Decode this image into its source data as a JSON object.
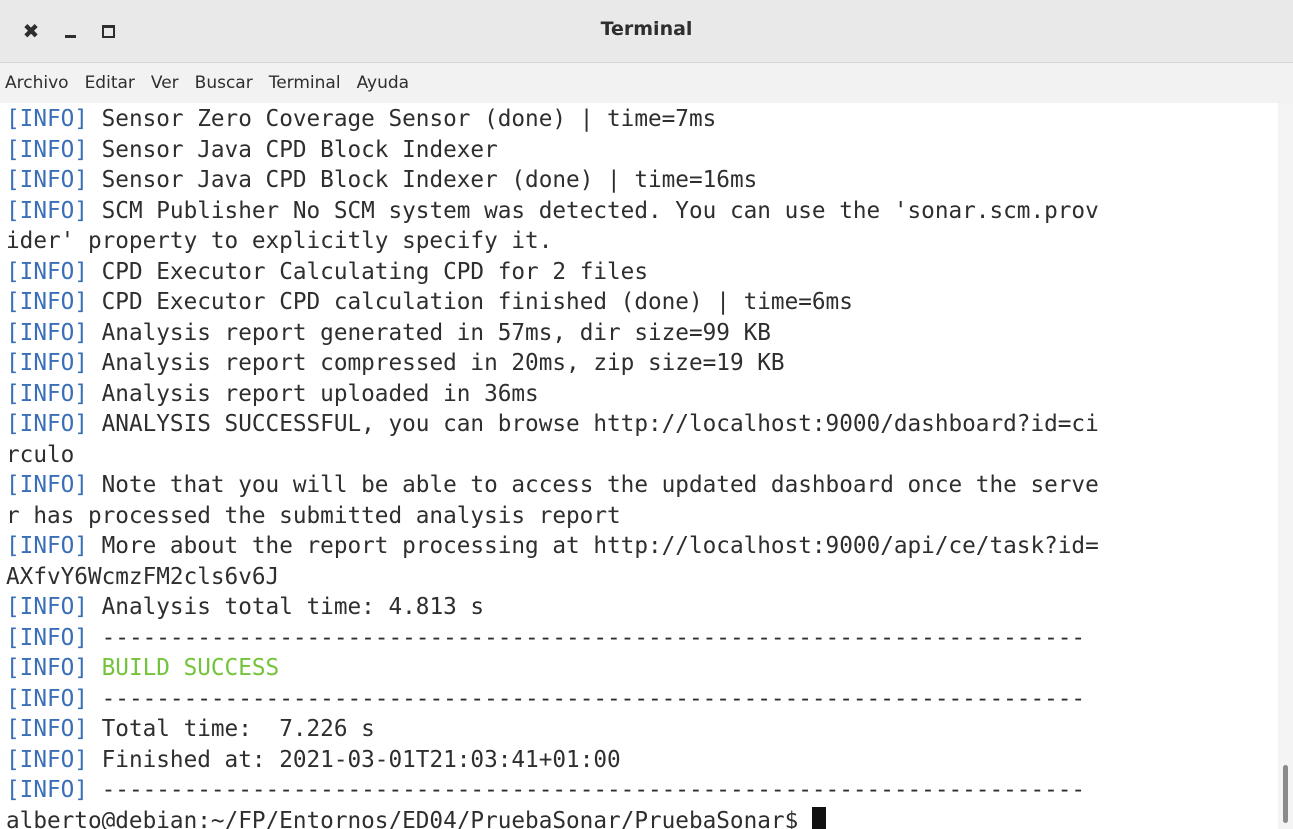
{
  "window": {
    "title": "Terminal",
    "controls": {
      "close": "✖"
    }
  },
  "menubar": {
    "items": [
      "Archivo",
      "Editar",
      "Ver",
      "Buscar",
      "Terminal",
      "Ayuda"
    ]
  },
  "terminal": {
    "lines": [
      {
        "tag": "[INFO]",
        "text": " Sensor Zero Coverage Sensor (done) | time=7ms"
      },
      {
        "tag": "[INFO]",
        "text": " Sensor Java CPD Block Indexer"
      },
      {
        "tag": "[INFO]",
        "text": " Sensor Java CPD Block Indexer (done) | time=16ms"
      },
      {
        "tag": "[INFO]",
        "text": " SCM Publisher No SCM system was detected. You can use the 'sonar.scm.prov"
      },
      {
        "tag": "",
        "text": "ider' property to explicitly specify it."
      },
      {
        "tag": "[INFO]",
        "text": " CPD Executor Calculating CPD for 2 files"
      },
      {
        "tag": "[INFO]",
        "text": " CPD Executor CPD calculation finished (done) | time=6ms"
      },
      {
        "tag": "[INFO]",
        "text": " Analysis report generated in 57ms, dir size=99 KB"
      },
      {
        "tag": "[INFO]",
        "text": " Analysis report compressed in 20ms, zip size=19 KB"
      },
      {
        "tag": "[INFO]",
        "text": " Analysis report uploaded in 36ms"
      },
      {
        "tag": "[INFO]",
        "text": " ANALYSIS SUCCESSFUL, you can browse http://localhost:9000/dashboard?id=ci"
      },
      {
        "tag": "",
        "text": "rculo"
      },
      {
        "tag": "[INFO]",
        "text": " Note that you will be able to access the updated dashboard once the serve"
      },
      {
        "tag": "",
        "text": "r has processed the submitted analysis report"
      },
      {
        "tag": "[INFO]",
        "text": " More about the report processing at http://localhost:9000/api/ce/task?id="
      },
      {
        "tag": "",
        "text": "AXfvY6WcmzFM2cls6v6J"
      },
      {
        "tag": "[INFO]",
        "text": " Analysis total time: 4.813 s"
      },
      {
        "tag": "[INFO]",
        "text": " ------------------------------------------------------------------------"
      },
      {
        "tag": "[INFO]",
        "text": " BUILD SUCCESS",
        "success": true
      },
      {
        "tag": "[INFO]",
        "text": " ------------------------------------------------------------------------"
      },
      {
        "tag": "[INFO]",
        "text": " Total time:  7.226 s"
      },
      {
        "tag": "[INFO]",
        "text": " Finished at: 2021-03-01T21:03:41+01:00"
      },
      {
        "tag": "[INFO]",
        "text": " ------------------------------------------------------------------------"
      }
    ],
    "prompt": "alberto@debian:~/FP/Entornos/ED04/PruebaSonar/PruebaSonar$ "
  },
  "colors": {
    "info_tag": "#3a6fb8",
    "success": "#73c43a",
    "text": "#2e2e2e"
  }
}
